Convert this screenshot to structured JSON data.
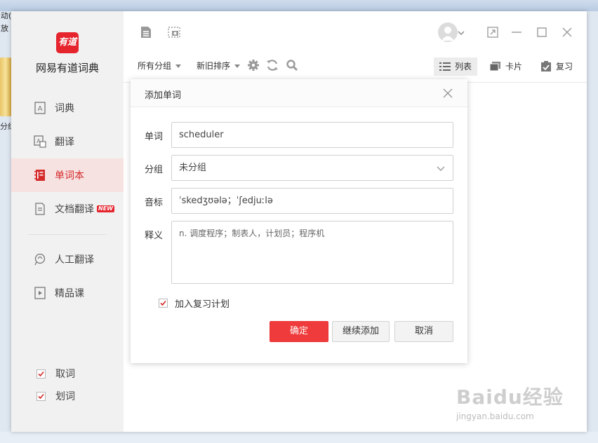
{
  "background": {
    "menu_items": [
      "动(H",
      "放"
    ],
    "folder_label": "分红"
  },
  "app": {
    "name": "网易有道词典",
    "logo_text": "有道"
  },
  "sidebar": {
    "items": [
      {
        "label": "词典",
        "icon": "dictionary-icon"
      },
      {
        "label": "翻译",
        "icon": "translate-icon"
      },
      {
        "label": "单词本",
        "icon": "wordbook-icon",
        "active": true
      },
      {
        "label": "文档翻译",
        "icon": "document-icon",
        "badge": "NEW"
      },
      {
        "label": "人工翻译",
        "icon": "human-translate-icon"
      },
      {
        "label": "精品课",
        "icon": "course-icon"
      }
    ],
    "checks": [
      {
        "label": "取词",
        "checked": true
      },
      {
        "label": "划词",
        "checked": true
      }
    ]
  },
  "toolbar": {
    "group_filter": "所有分组",
    "sort_order": "新旧排序",
    "views": [
      "列表",
      "卡片",
      "复习"
    ],
    "active_view": "列表"
  },
  "dialog": {
    "title": "添加单词",
    "word_label": "单词",
    "word_value": "scheduler",
    "group_label": "分组",
    "group_value": "未分组",
    "phonetic_label": "音标",
    "phonetic_value": "ˈskedʒʊələ；ˈʃedjuːlə",
    "meaning_label": "释义",
    "meaning_value": "n. 调度程序；制表人，计划员；程序机",
    "review_plan_label": "加入复习计划",
    "review_plan_checked": true,
    "confirm_label": "确定",
    "continue_label": "继续添加",
    "cancel_label": "取消"
  },
  "colors": {
    "accent": "#e5242e",
    "active_nav_bg": "#f7e2e2",
    "primary_button": "#ef3b3b"
  },
  "watermark": {
    "brand": "Baidu经验",
    "url": "jingyan.baidu.com"
  }
}
